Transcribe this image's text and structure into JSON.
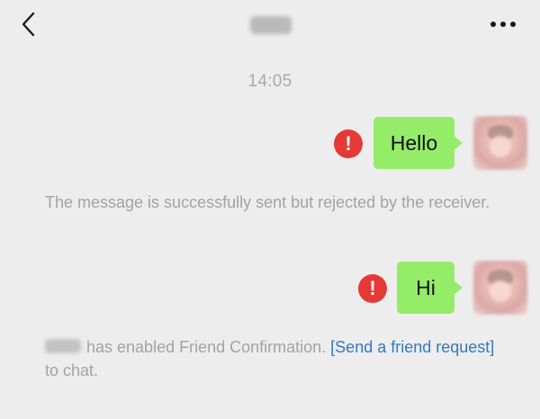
{
  "header": {
    "back_icon": "chevron-left-icon",
    "more_icon": "more-dots-icon",
    "title_hidden": true
  },
  "conversation": {
    "timestamp": "14:05",
    "messages": [
      {
        "text": "Hello",
        "status_icon": "error-exclamation-icon",
        "status_color": "#e53935",
        "bubble_color": "#95ec69"
      },
      {
        "text": "Hi",
        "status_icon": "error-exclamation-icon",
        "status_color": "#e53935",
        "bubble_color": "#95ec69"
      }
    ],
    "system_notice_1": "The message is successfully sent but rejected by the receiver.",
    "system_notice_2": {
      "before": "has enabled Friend Confirmation.",
      "link": "[Send a friend request]",
      "after": "to chat."
    },
    "alert_symbol": "!"
  },
  "colors": {
    "background": "#ededed",
    "bubble": "#95ec69",
    "error": "#e53935",
    "link": "#3178c6",
    "muted_text": "#a3a3a3"
  }
}
